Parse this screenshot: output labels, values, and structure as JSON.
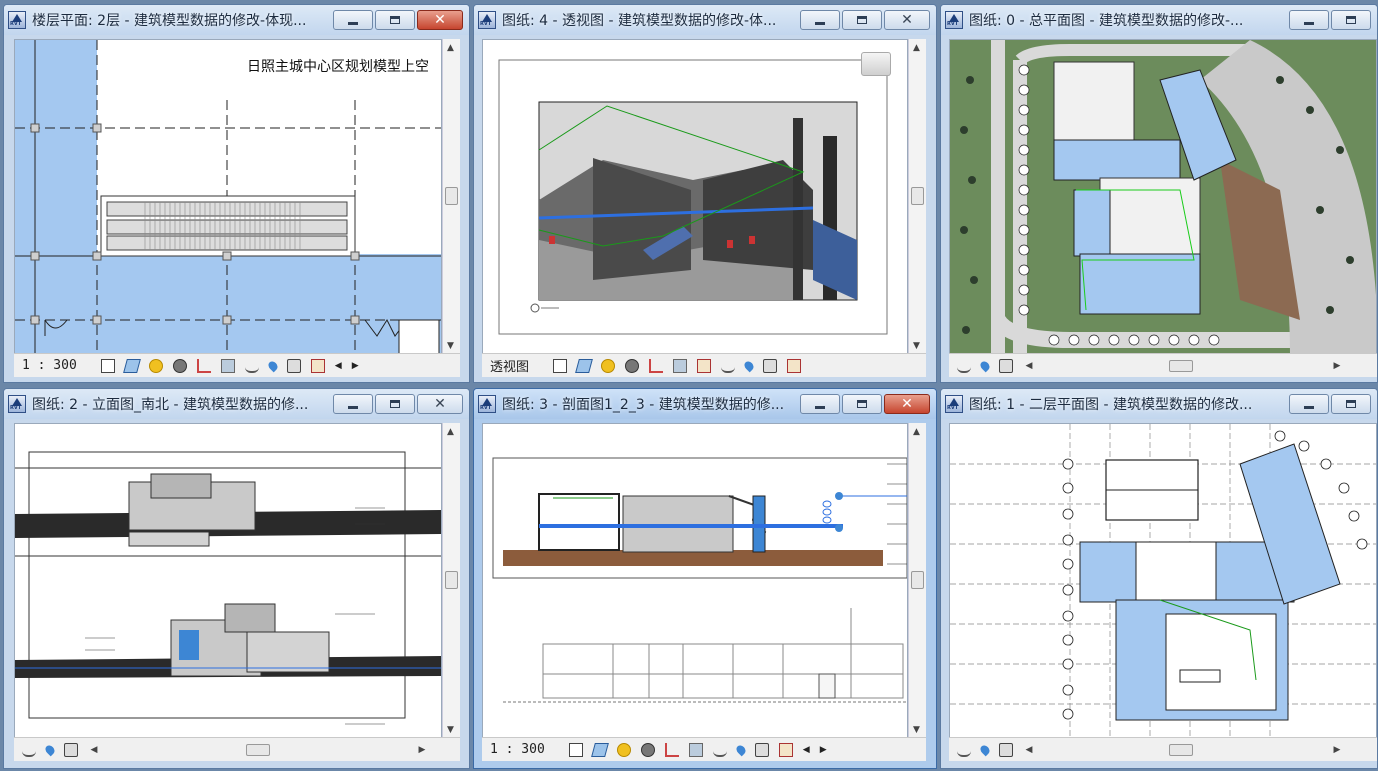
{
  "windows": [
    {
      "title": "楼层平面: 2层 - 建筑模型数据的修改-体现...",
      "scale": "1 : 300",
      "annotation": "日照主城中心区规划模型上空",
      "active": false
    },
    {
      "title": "图纸: 4 - 透视图 - 建筑模型数据的修改-体...",
      "view_label": "透视图",
      "active": false
    },
    {
      "title": "图纸: 0 - 总平面图 - 建筑模型数据的修改-...",
      "active": false
    },
    {
      "title": "图纸: 2 - 立面图_南北 - 建筑模型数据的修...",
      "active": false
    },
    {
      "title": "图纸: 3 - 剖面图1_2_3 - 建筑模型数据的修...",
      "scale": "1 : 300",
      "active": true
    },
    {
      "title": "图纸: 1 - 二层平面图 - 建筑模型数据的修改...",
      "active": false
    }
  ],
  "icons": {
    "app": "revit-app-icon",
    "minimize": "minimize-icon",
    "maximize": "maximize-icon",
    "close": "close-icon",
    "view_cube": "view-cube-icon"
  },
  "app_icon_text": "RVT",
  "colors": {
    "frame": "#c7d8ec",
    "active_frame": "#aecbec",
    "plan_blue": "#a4c8f0",
    "site_green": "#6c8c5c",
    "close_red": "#c6452f"
  }
}
